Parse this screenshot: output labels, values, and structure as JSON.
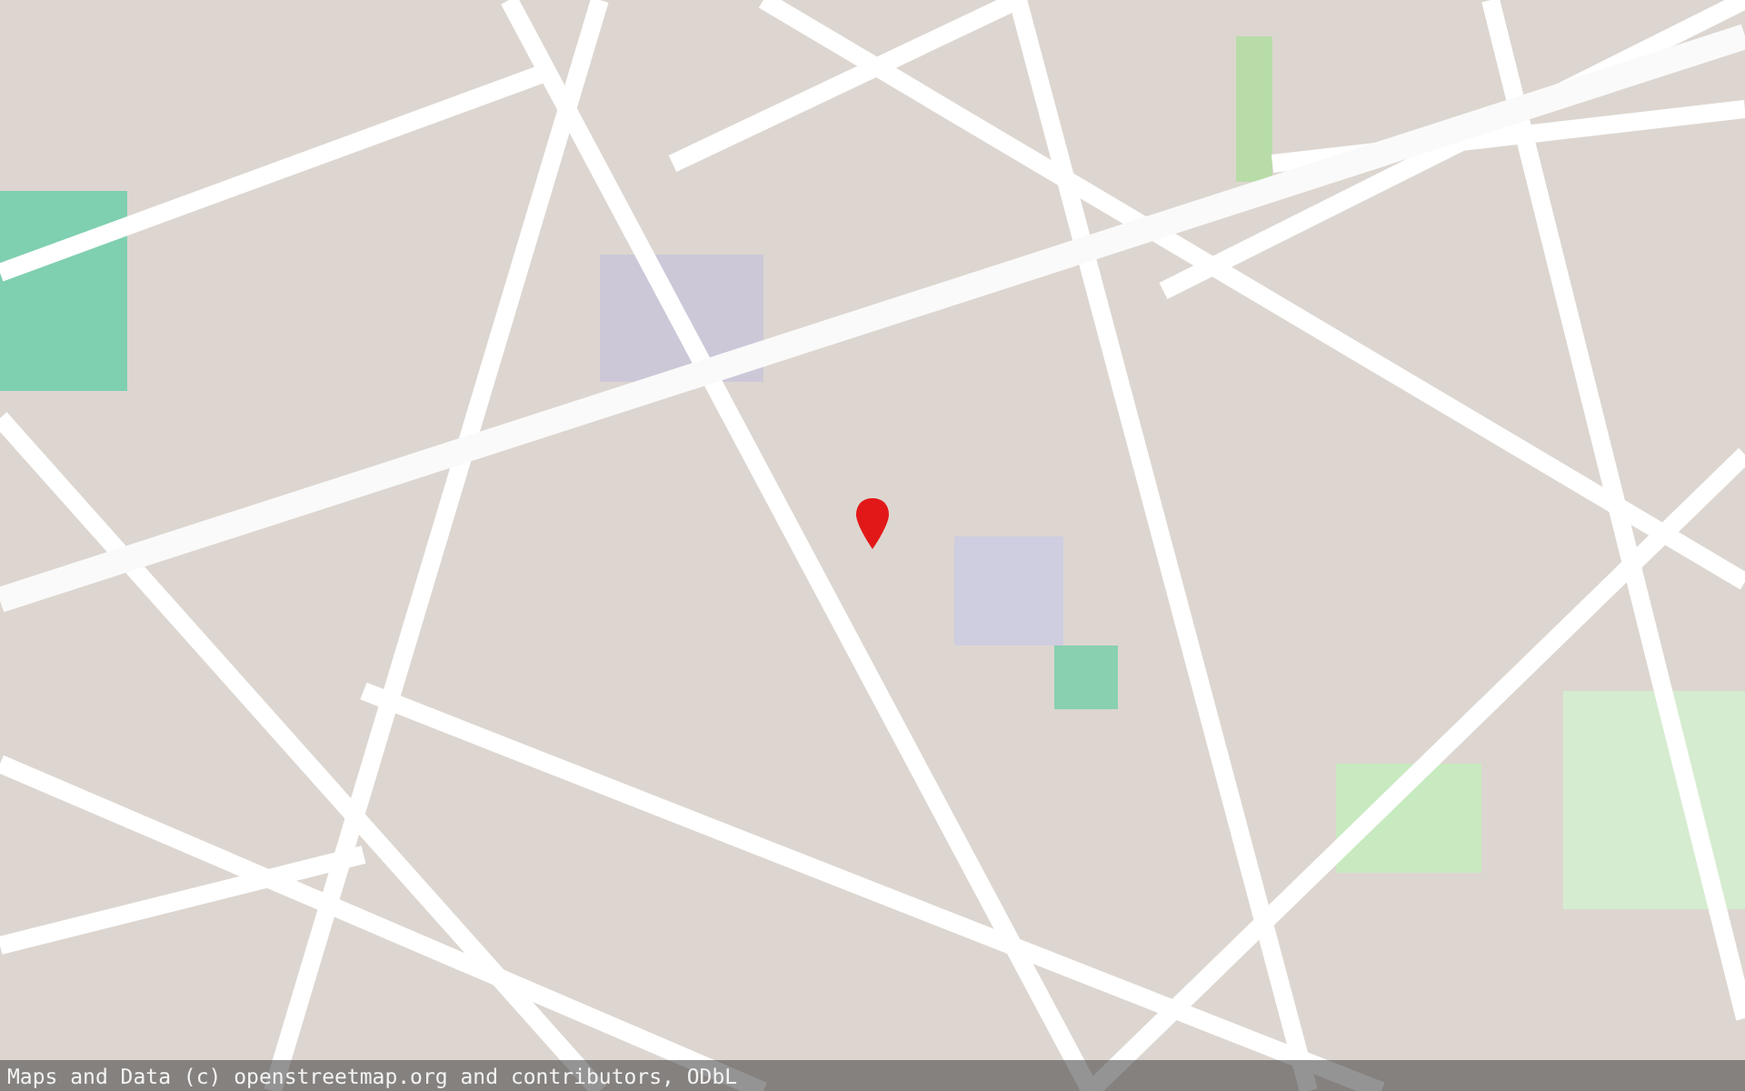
{
  "attribution": "Maps and Data (c) openstreetmap.org and contributors, ODbL"
}
